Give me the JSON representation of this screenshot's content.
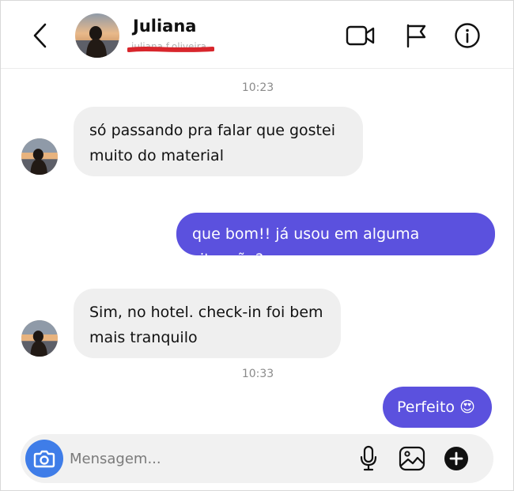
{
  "header": {
    "contact_name": "Juliana",
    "contact_username": "juliana.f.oliveira",
    "icons": [
      "back-chevron-icon",
      "video-call-icon",
      "flag-icon",
      "info-icon"
    ]
  },
  "messages": [
    {
      "type": "time",
      "text": "10:23"
    },
    {
      "type": "incoming",
      "line1": "só passando pra falar que gostei",
      "line2": "muito do material"
    },
    {
      "type": "outgoing",
      "text": "que bom!! já usou em alguma situação?"
    },
    {
      "type": "incoming",
      "line1": "Sim, no hotel. check-in foi bem",
      "line2": "mais tranquilo"
    },
    {
      "type": "time",
      "text": "10:33"
    },
    {
      "type": "outgoing",
      "text": "Perfeito",
      "emoji": "😍"
    }
  ],
  "composer": {
    "placeholder": "Mensagem...",
    "icons": [
      "camera-icon",
      "microphone-icon",
      "gallery-icon",
      "add-icon"
    ]
  },
  "colors": {
    "outgoing_bubble": "#5b51de",
    "incoming_bubble": "#efefef",
    "camera_button": "#3f7de8",
    "redaction": "#d8262c"
  }
}
